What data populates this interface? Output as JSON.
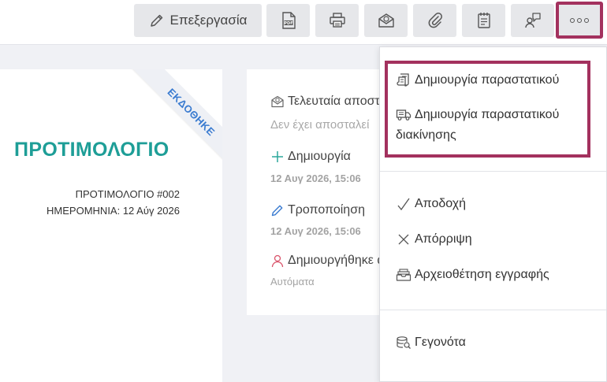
{
  "toolbar": {
    "edit_label": "Επεξεργασία"
  },
  "document": {
    "ribbon_text": "ΕΚΔΟΘΗΚΕ",
    "title": "ΠΡΟΤΙΜΟΛΟΓΙΟ",
    "number_line": "ΠΡΟΤΙΜΟΛΟΓΙΟ #002",
    "date_line": "ΗΜΕΡΟΜΗΝΙΑ: 12 Αύγ 2026"
  },
  "info": {
    "last_sent_title": "Τελευταία αποστολή",
    "last_sent_value": "Δεν έχει αποσταλεί",
    "created_title": "Δημιουργία",
    "created_date": "12 Αυγ 2026, 15:06",
    "modified_title": "Τροποποίηση",
    "modified_date": "12 Αυγ 2026, 15:06",
    "created_by_title": "Δημιουργήθηκε από",
    "created_by_value": "Αυτόματα"
  },
  "menu": {
    "create_document": "Δημιουργία παραστατικού",
    "create_delivery_line1": "Δημιουργία παραστατικού",
    "create_delivery_line2": "διακίνησης",
    "accept": "Αποδοχή",
    "reject": "Απόρριψη",
    "archive": "Αρχειοθέτηση εγγραφής",
    "events": "Γεγονότα"
  },
  "colors": {
    "highlight": "#a3315e",
    "title_teal": "#1e9e97",
    "ribbon_blue": "#3a7bd0",
    "plus_green": "#2aa79b",
    "pencil_blue": "#3a7bd0",
    "user_red": "#d9536a"
  }
}
